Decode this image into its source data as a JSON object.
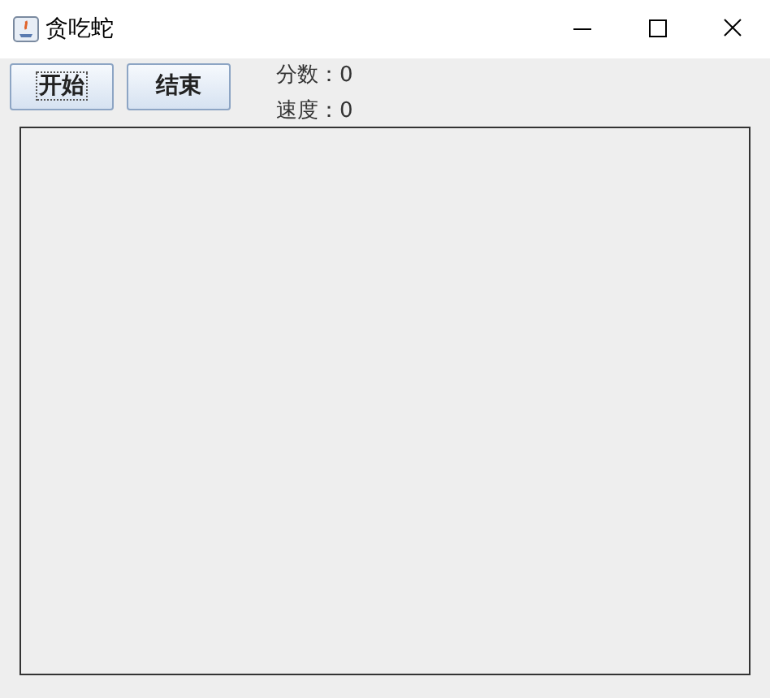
{
  "window": {
    "title": "贪吃蛇"
  },
  "buttons": [
    {
      "label": "开始",
      "focused": true
    },
    {
      "label": "结束",
      "focused": false
    }
  ],
  "stats": [
    "分数：0",
    "速度：0"
  ]
}
